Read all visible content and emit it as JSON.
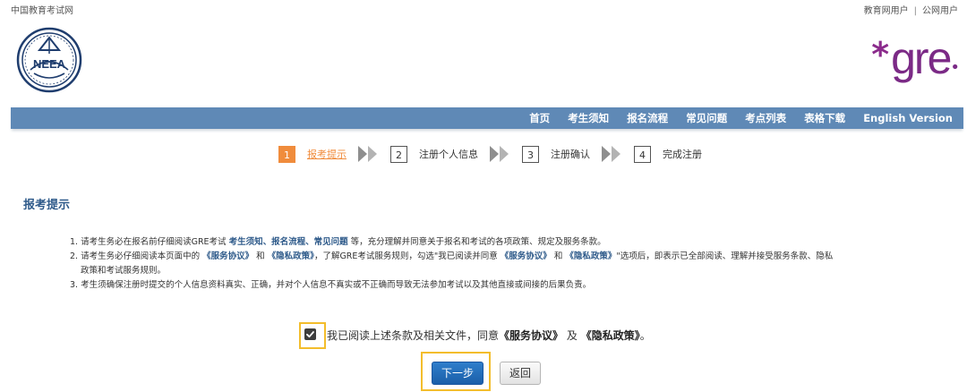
{
  "topbar": {
    "site_name": "中国教育考试网",
    "edu_user": "教育网用户",
    "public_user": "公网用户",
    "separator": "|"
  },
  "logos": {
    "neea_text": "NEEA",
    "gre_text": "gre",
    "gre_star": "*"
  },
  "nav": {
    "items": [
      "首页",
      "考生须知",
      "报名流程",
      "常见问题",
      "考点列表",
      "表格下载",
      "English Version"
    ]
  },
  "steps": [
    {
      "num": "1",
      "label": "报考提示",
      "active": true
    },
    {
      "num": "2",
      "label": "注册个人信息",
      "active": false
    },
    {
      "num": "3",
      "label": "注册确认",
      "active": false
    },
    {
      "num": "4",
      "label": "完成注册",
      "active": false
    }
  ],
  "section_title": "报考提示",
  "notices": {
    "n1_a": "1. 请考生务必在报名前仔细阅读GRE考试 ",
    "n1_b1": "考生须知",
    "n1_s1": "、",
    "n1_b2": "报名流程",
    "n1_s2": "、",
    "n1_b3": "常见问题",
    "n1_c": " 等，充分理解并同意关于报名和考试的各项政策、规定及服务条款。",
    "n2_a": "2. 请考生务必仔细阅读本页面中的 ",
    "n2_b1": "《服务协议》",
    "n2_s1": " 和 ",
    "n2_b2": "《隐私政策》",
    "n2_c": "，了解GRE考试服务规则，勾选\"我已阅读并同意 ",
    "n2_b3": "《服务协议》",
    "n2_s2": " 和 ",
    "n2_b4": "《隐私政策》",
    "n2_d": "\"选项后，即表示已全部阅读、理解并接受服务条款、隐私",
    "n2_e": "政策和考试服务规则。",
    "n3": "3. 考生须确保注册时提交的个人信息资料真实、正确，并对个人信息不真实或不正确而导致无法参加考试以及其他直接或间接的后果负责。"
  },
  "agree": {
    "checked": true,
    "text_a": "我已阅读上述条款及相关文件，同意",
    "link1": "《服务协议》",
    "text_b": "及",
    "link2": "《隐私政策》",
    "text_c": "。"
  },
  "buttons": {
    "next": "下一步",
    "back": "返回"
  },
  "colors": {
    "nav_bg": "#5f89b6",
    "step_active": "#f08c3c",
    "title": "#2e5a8a",
    "highlight": "#f3bd2c",
    "gre_purple": "#7b2a86"
  }
}
